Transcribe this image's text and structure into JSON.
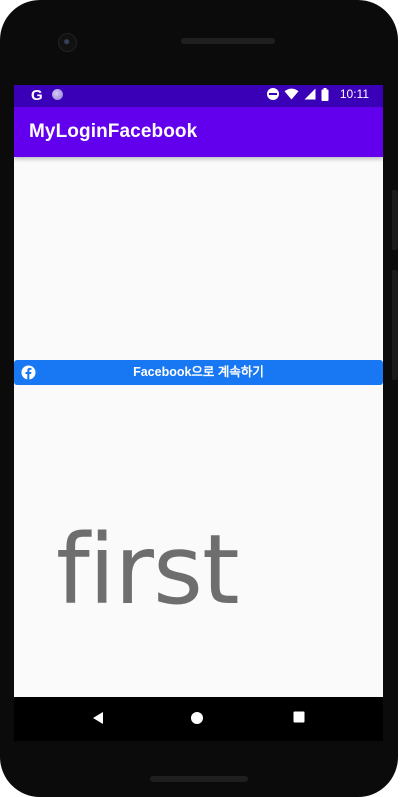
{
  "status_bar": {
    "google_glyph": "G",
    "time": "10:11",
    "icons": [
      "google-g-icon",
      "notification-dot-icon",
      "do-not-disturb-icon",
      "wifi-icon",
      "cell-signal-icon",
      "battery-icon"
    ]
  },
  "app_bar": {
    "title": "MyLoginFacebook",
    "color": "#6200ee"
  },
  "facebook_button": {
    "label": "Facebook으로 계속하기",
    "icon": "facebook-icon",
    "color": "#1877f2"
  },
  "content": {
    "big_text": "first"
  },
  "navigation": {
    "icons": [
      "back-icon",
      "home-icon",
      "recents-icon"
    ]
  },
  "colors": {
    "status_bar": "#3a00b8",
    "background": "#fafafa",
    "big_text": "#6e6e6e"
  }
}
